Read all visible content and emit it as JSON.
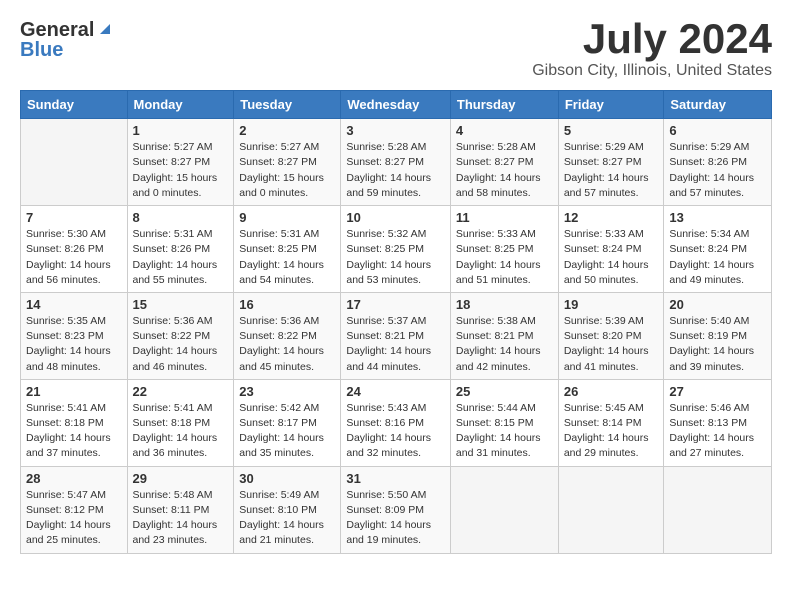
{
  "header": {
    "logo_general": "General",
    "logo_blue": "Blue",
    "title": "July 2024",
    "subtitle": "Gibson City, Illinois, United States"
  },
  "calendar": {
    "days_of_week": [
      "Sunday",
      "Monday",
      "Tuesday",
      "Wednesday",
      "Thursday",
      "Friday",
      "Saturday"
    ],
    "weeks": [
      [
        {
          "day": "",
          "info": ""
        },
        {
          "day": "1",
          "info": "Sunrise: 5:27 AM\nSunset: 8:27 PM\nDaylight: 15 hours\nand 0 minutes."
        },
        {
          "day": "2",
          "info": "Sunrise: 5:27 AM\nSunset: 8:27 PM\nDaylight: 15 hours\nand 0 minutes."
        },
        {
          "day": "3",
          "info": "Sunrise: 5:28 AM\nSunset: 8:27 PM\nDaylight: 14 hours\nand 59 minutes."
        },
        {
          "day": "4",
          "info": "Sunrise: 5:28 AM\nSunset: 8:27 PM\nDaylight: 14 hours\nand 58 minutes."
        },
        {
          "day": "5",
          "info": "Sunrise: 5:29 AM\nSunset: 8:27 PM\nDaylight: 14 hours\nand 57 minutes."
        },
        {
          "day": "6",
          "info": "Sunrise: 5:29 AM\nSunset: 8:26 PM\nDaylight: 14 hours\nand 57 minutes."
        }
      ],
      [
        {
          "day": "7",
          "info": "Sunrise: 5:30 AM\nSunset: 8:26 PM\nDaylight: 14 hours\nand 56 minutes."
        },
        {
          "day": "8",
          "info": "Sunrise: 5:31 AM\nSunset: 8:26 PM\nDaylight: 14 hours\nand 55 minutes."
        },
        {
          "day": "9",
          "info": "Sunrise: 5:31 AM\nSunset: 8:25 PM\nDaylight: 14 hours\nand 54 minutes."
        },
        {
          "day": "10",
          "info": "Sunrise: 5:32 AM\nSunset: 8:25 PM\nDaylight: 14 hours\nand 53 minutes."
        },
        {
          "day": "11",
          "info": "Sunrise: 5:33 AM\nSunset: 8:25 PM\nDaylight: 14 hours\nand 51 minutes."
        },
        {
          "day": "12",
          "info": "Sunrise: 5:33 AM\nSunset: 8:24 PM\nDaylight: 14 hours\nand 50 minutes."
        },
        {
          "day": "13",
          "info": "Sunrise: 5:34 AM\nSunset: 8:24 PM\nDaylight: 14 hours\nand 49 minutes."
        }
      ],
      [
        {
          "day": "14",
          "info": "Sunrise: 5:35 AM\nSunset: 8:23 PM\nDaylight: 14 hours\nand 48 minutes."
        },
        {
          "day": "15",
          "info": "Sunrise: 5:36 AM\nSunset: 8:22 PM\nDaylight: 14 hours\nand 46 minutes."
        },
        {
          "day": "16",
          "info": "Sunrise: 5:36 AM\nSunset: 8:22 PM\nDaylight: 14 hours\nand 45 minutes."
        },
        {
          "day": "17",
          "info": "Sunrise: 5:37 AM\nSunset: 8:21 PM\nDaylight: 14 hours\nand 44 minutes."
        },
        {
          "day": "18",
          "info": "Sunrise: 5:38 AM\nSunset: 8:21 PM\nDaylight: 14 hours\nand 42 minutes."
        },
        {
          "day": "19",
          "info": "Sunrise: 5:39 AM\nSunset: 8:20 PM\nDaylight: 14 hours\nand 41 minutes."
        },
        {
          "day": "20",
          "info": "Sunrise: 5:40 AM\nSunset: 8:19 PM\nDaylight: 14 hours\nand 39 minutes."
        }
      ],
      [
        {
          "day": "21",
          "info": "Sunrise: 5:41 AM\nSunset: 8:18 PM\nDaylight: 14 hours\nand 37 minutes."
        },
        {
          "day": "22",
          "info": "Sunrise: 5:41 AM\nSunset: 8:18 PM\nDaylight: 14 hours\nand 36 minutes."
        },
        {
          "day": "23",
          "info": "Sunrise: 5:42 AM\nSunset: 8:17 PM\nDaylight: 14 hours\nand 35 minutes."
        },
        {
          "day": "24",
          "info": "Sunrise: 5:43 AM\nSunset: 8:16 PM\nDaylight: 14 hours\nand 32 minutes."
        },
        {
          "day": "25",
          "info": "Sunrise: 5:44 AM\nSunset: 8:15 PM\nDaylight: 14 hours\nand 31 minutes."
        },
        {
          "day": "26",
          "info": "Sunrise: 5:45 AM\nSunset: 8:14 PM\nDaylight: 14 hours\nand 29 minutes."
        },
        {
          "day": "27",
          "info": "Sunrise: 5:46 AM\nSunset: 8:13 PM\nDaylight: 14 hours\nand 27 minutes."
        }
      ],
      [
        {
          "day": "28",
          "info": "Sunrise: 5:47 AM\nSunset: 8:12 PM\nDaylight: 14 hours\nand 25 minutes."
        },
        {
          "day": "29",
          "info": "Sunrise: 5:48 AM\nSunset: 8:11 PM\nDaylight: 14 hours\nand 23 minutes."
        },
        {
          "day": "30",
          "info": "Sunrise: 5:49 AM\nSunset: 8:10 PM\nDaylight: 14 hours\nand 21 minutes."
        },
        {
          "day": "31",
          "info": "Sunrise: 5:50 AM\nSunset: 8:09 PM\nDaylight: 14 hours\nand 19 minutes."
        },
        {
          "day": "",
          "info": ""
        },
        {
          "day": "",
          "info": ""
        },
        {
          "day": "",
          "info": ""
        }
      ]
    ]
  }
}
